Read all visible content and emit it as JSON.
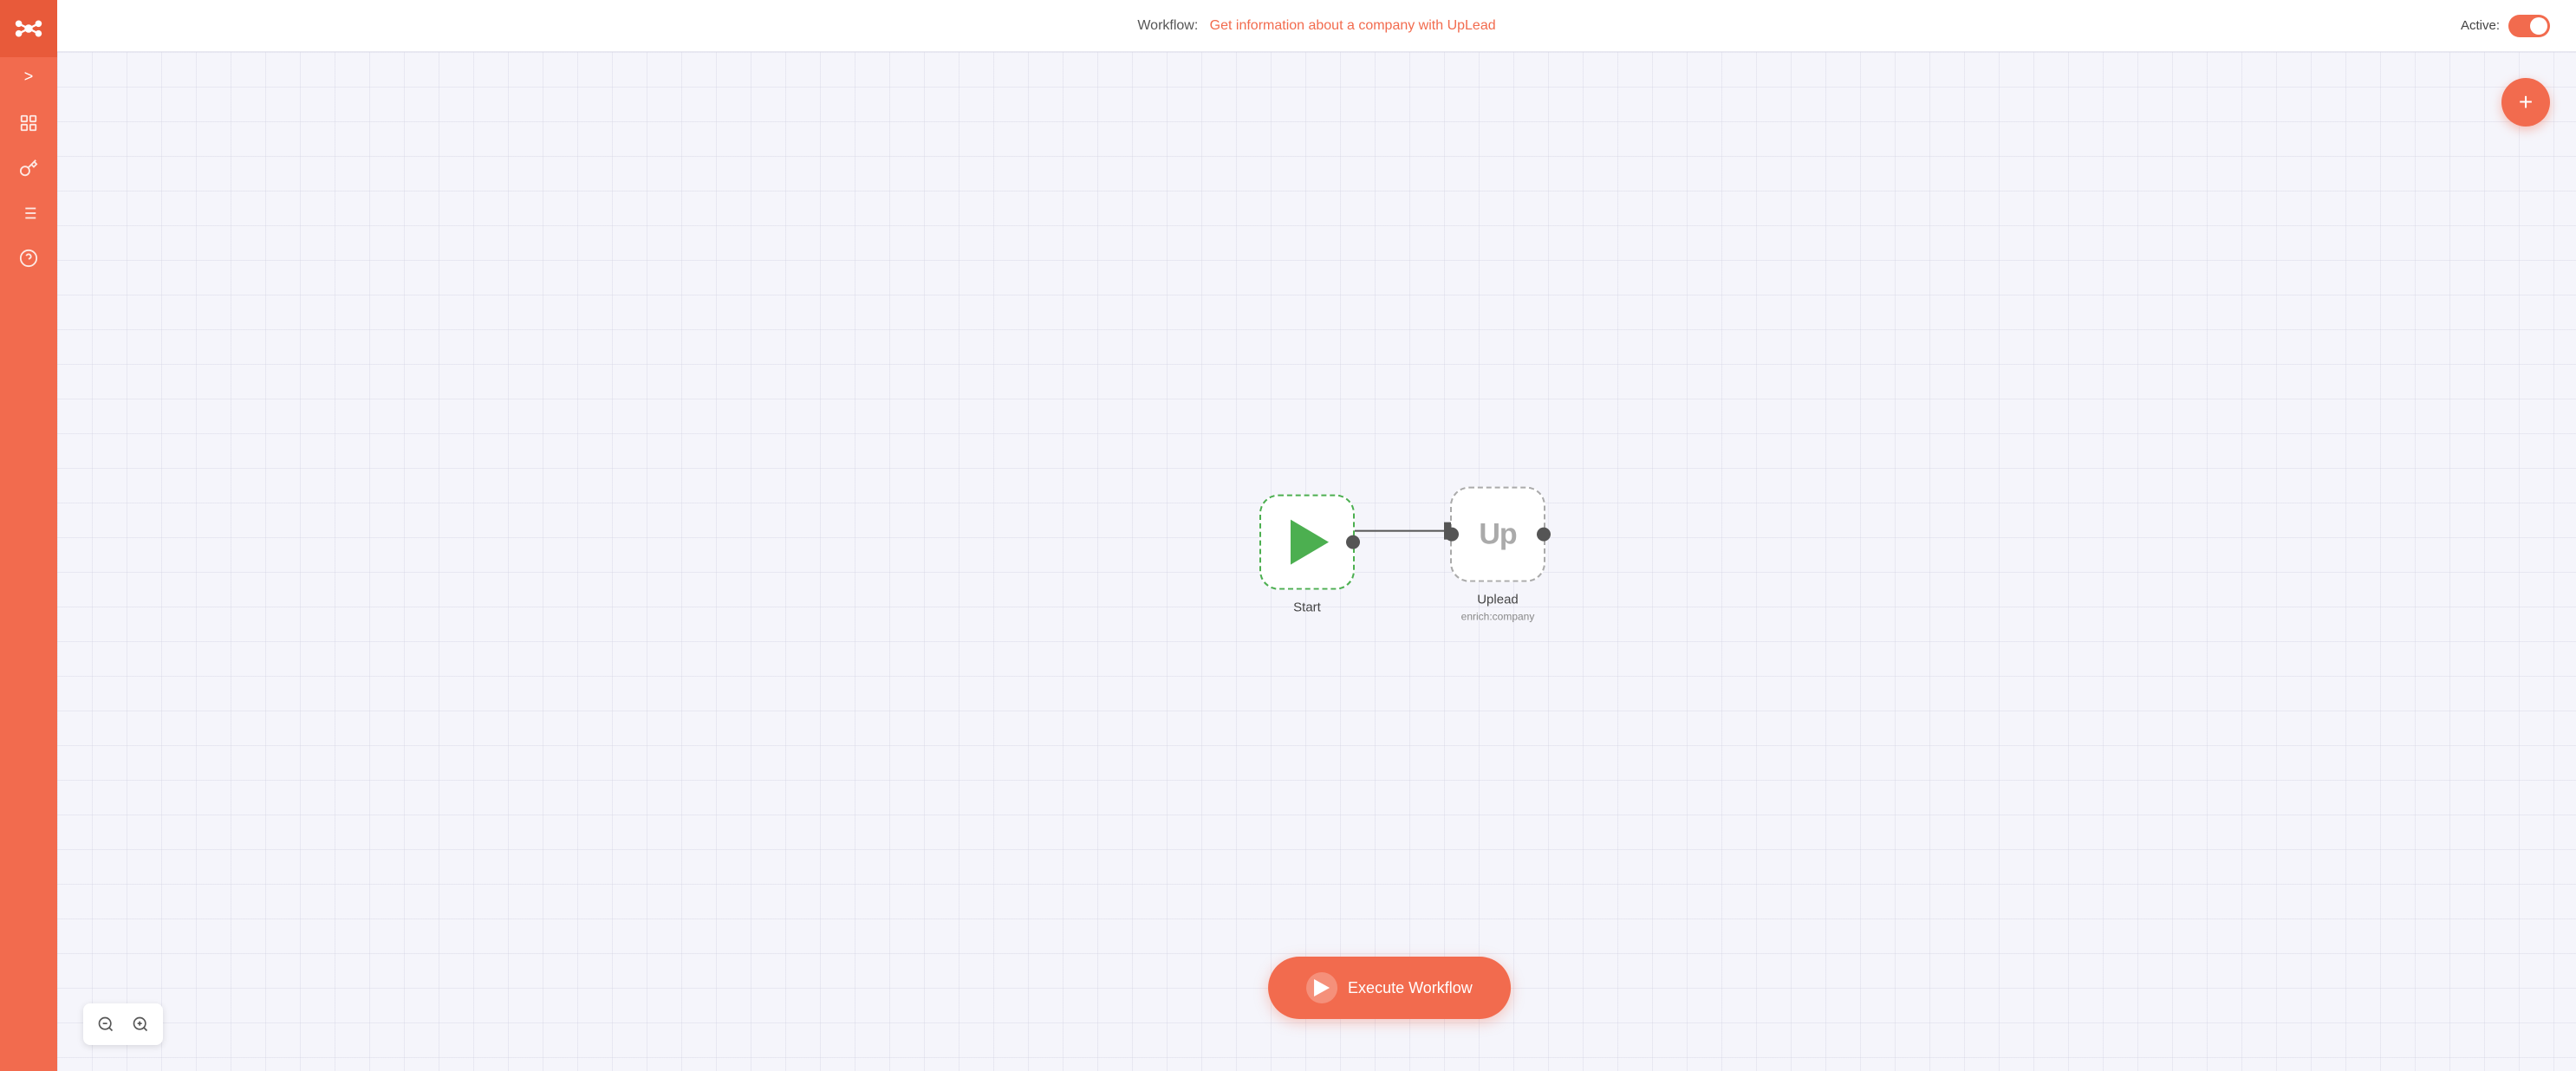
{
  "sidebar": {
    "logo_alt": "n8n logo",
    "toggle_label": ">",
    "nav_items": [
      {
        "id": "workflows",
        "icon": "network-icon",
        "label": "Workflows"
      },
      {
        "id": "credentials",
        "icon": "key-icon",
        "label": "Credentials"
      },
      {
        "id": "executions",
        "icon": "list-icon",
        "label": "Executions"
      },
      {
        "id": "help",
        "icon": "help-icon",
        "label": "Help"
      }
    ]
  },
  "header": {
    "prefix": "Workflow:",
    "title": "Get information about a company with UpLead",
    "active_label": "Active:",
    "active_state": true
  },
  "canvas": {
    "fab_label": "+",
    "nodes": [
      {
        "id": "start",
        "type": "start",
        "label": "Start",
        "sublabel": ""
      },
      {
        "id": "uplead",
        "type": "uplead",
        "label": "Uplead",
        "sublabel": "enrich:company"
      }
    ]
  },
  "execute_button": {
    "label": "Execute Workflow"
  },
  "zoom": {
    "zoom_in_label": "zoom-in",
    "zoom_out_label": "zoom-out"
  }
}
